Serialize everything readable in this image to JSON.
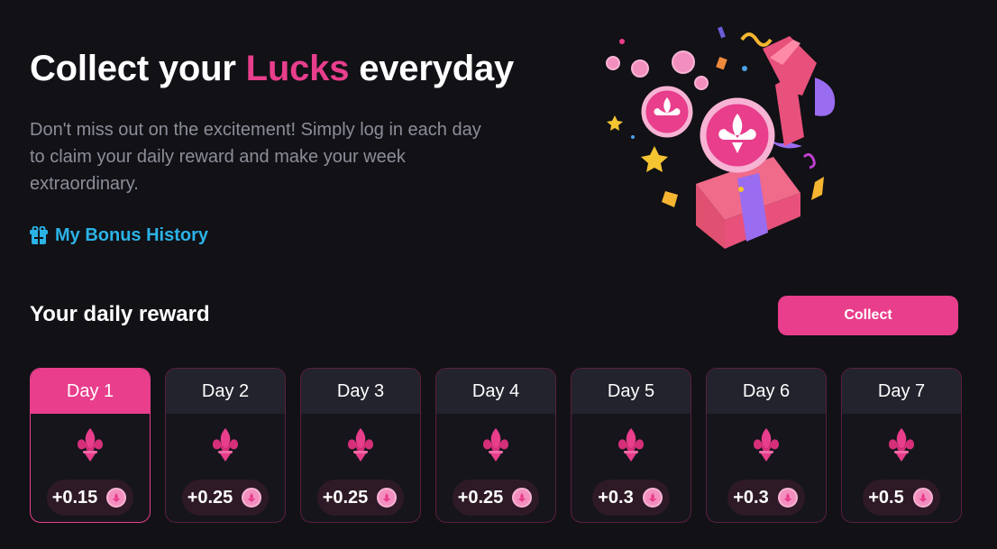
{
  "hero": {
    "title_prefix": "Collect your ",
    "title_accent": "Lucks",
    "title_suffix": " everyday",
    "description": "Don't miss out on the excitement! Simply log in each day to claim your daily reward and make your week extraordinary.",
    "bonus_history_label": "My Bonus History",
    "bonus_icon": "gift-icon"
  },
  "rewards": {
    "section_title": "Your daily reward",
    "collect_label": "Collect",
    "days": [
      {
        "label": "Day 1",
        "amount": "+0.15",
        "active": true
      },
      {
        "label": "Day 2",
        "amount": "+0.25",
        "active": false
      },
      {
        "label": "Day 3",
        "amount": "+0.25",
        "active": false
      },
      {
        "label": "Day 4",
        "amount": "+0.25",
        "active": false
      },
      {
        "label": "Day 5",
        "amount": "+0.3",
        "active": false
      },
      {
        "label": "Day 6",
        "amount": "+0.3",
        "active": false
      },
      {
        "label": "Day 7",
        "amount": "+0.5",
        "active": false
      }
    ],
    "reward_icon": "fleur-de-lis-icon",
    "coin_icon": "luck-coin-icon"
  },
  "colors": {
    "accent": "#e83e8c",
    "link": "#2bb3e6",
    "background": "#111116"
  }
}
